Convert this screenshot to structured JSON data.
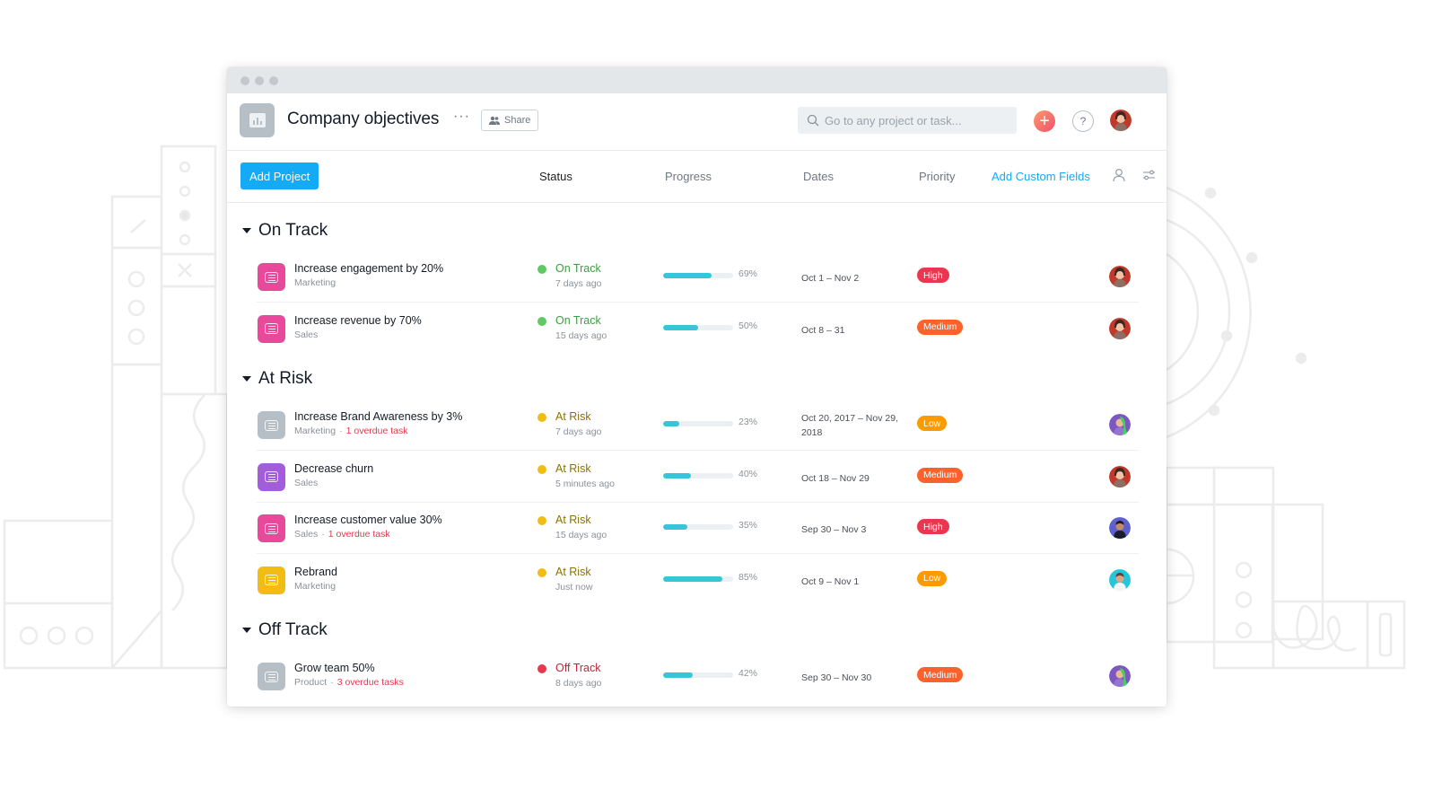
{
  "window": {
    "title": "Company objectives",
    "more_label": "···",
    "share_label": "Share",
    "search_placeholder": "Go to any project or task...",
    "plus_label": "+",
    "help_label": "?"
  },
  "toolbar": {
    "add_project_label": "Add Project",
    "columns": {
      "status": "Status",
      "progress": "Progress",
      "dates": "Dates",
      "priority": "Priority",
      "add_custom_fields": "Add Custom Fields"
    }
  },
  "colors": {
    "accent": "#14aaf5",
    "on_track": "#5fca64",
    "at_risk": "#f1bd13",
    "off_track": "#e8384f",
    "progress_fill": "#37c5d8",
    "priority_high": "#e8384f",
    "priority_medium": "#fd612c",
    "priority_low": "#fd9a00"
  },
  "sections": [
    {
      "title": "On Track",
      "rows": [
        {
          "name": "Increase engagement by 20%",
          "team": "Marketing",
          "overdue": "",
          "status": "On Track",
          "status_time": "7 days ago",
          "progress_pct": 69,
          "progress_label": "69%",
          "dates": "Oct 1 – Nov 2",
          "priority": "High",
          "icon_color": "#e8499a",
          "avatar": "woman-red"
        },
        {
          "name": "Increase revenue by 70%",
          "team": "Sales",
          "overdue": "",
          "status": "On Track",
          "status_time": "15 days ago",
          "progress_pct": 50,
          "progress_label": "50%",
          "dates": "Oct 8 – 31",
          "priority": "Medium",
          "icon_color": "#e8499a",
          "avatar": "woman-red"
        }
      ]
    },
    {
      "title": "At Risk",
      "rows": [
        {
          "name": "Increase Brand Awareness by 3%",
          "team": "Marketing",
          "overdue": "1 overdue task",
          "status": "At Risk",
          "status_time": "7 days ago",
          "progress_pct": 23,
          "progress_label": "23%",
          "dates": "Oct 20, 2017 – Nov 29, 2018",
          "priority": "Low",
          "icon_color": "#b7bfc6",
          "avatar": "person-green"
        },
        {
          "name": "Decrease churn",
          "team": "Sales",
          "overdue": "",
          "status": "At Risk",
          "status_time": "5 minutes ago",
          "progress_pct": 40,
          "progress_label": "40%",
          "dates": "Oct 18 – Nov 29",
          "priority": "Medium",
          "icon_color": "#a25ddc",
          "avatar": "woman-red"
        },
        {
          "name": "Increase customer value 30%",
          "team": "Sales",
          "overdue": "1 overdue task",
          "status": "At Risk",
          "status_time": "15 days ago",
          "progress_pct": 35,
          "progress_label": "35%",
          "dates": "Sep 30 – Nov 3",
          "priority": "High",
          "icon_color": "#e8499a",
          "avatar": "man-purple"
        },
        {
          "name": "Rebrand",
          "team": "Marketing",
          "overdue": "",
          "status": "At Risk",
          "status_time": "Just now",
          "progress_pct": 85,
          "progress_label": "85%",
          "dates": "Oct 9 – Nov 1",
          "priority": "Low",
          "icon_color": "#f1bd13",
          "avatar": "man-teal"
        }
      ]
    },
    {
      "title": "Off Track",
      "rows": [
        {
          "name": "Grow team 50%",
          "team": "Product",
          "overdue": "3 overdue tasks",
          "status": "Off Track",
          "status_time": "8 days ago",
          "progress_pct": 42,
          "progress_label": "42%",
          "dates": "Sep 30 – Nov 30",
          "priority": "Medium",
          "icon_color": "#b7bfc6",
          "avatar": "person-green"
        }
      ]
    }
  ],
  "icons": {
    "project": "chart-icon",
    "share": "people-icon",
    "search": "search-icon",
    "plus": "plus-icon",
    "help": "help-icon",
    "row": "list-icon",
    "people_filter": "person-icon",
    "settings": "sliders-icon",
    "collapse": "caret-down-icon"
  }
}
